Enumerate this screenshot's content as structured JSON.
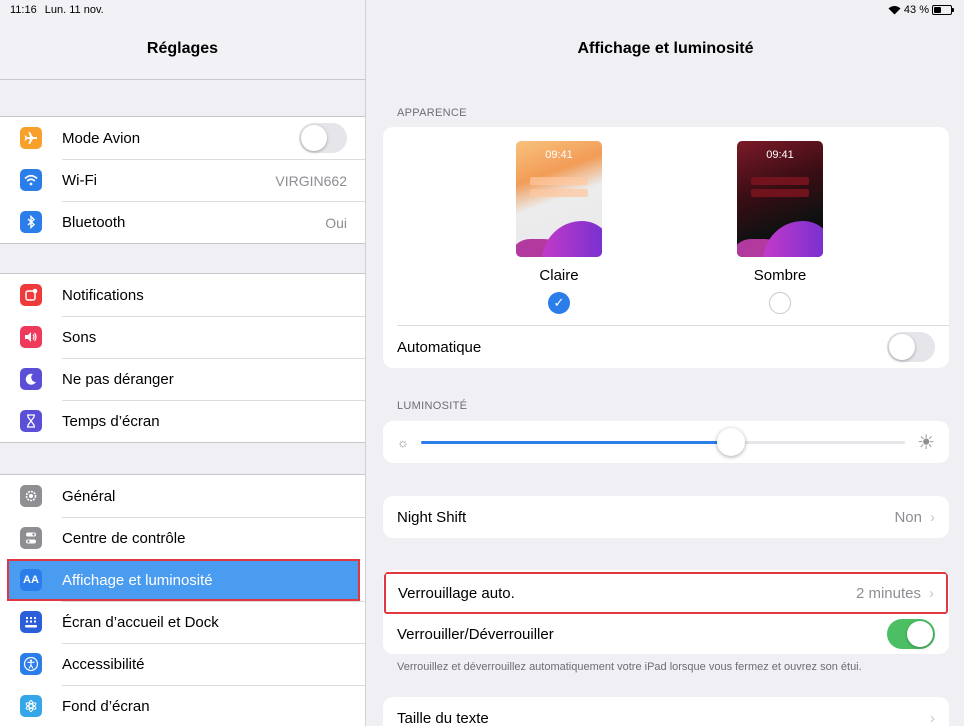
{
  "status_bar": {
    "time": "11:16",
    "date": "Lun. 11 nov.",
    "battery": "43 %",
    "battery_level": 0.43
  },
  "sidebar": {
    "title": "Réglages",
    "groups": [
      [
        {
          "label": "Mode Avion",
          "icon": "airplane-icon",
          "color": "#f7a12c",
          "toggle": false
        },
        {
          "label": "Wi-Fi",
          "icon": "wifi-icon",
          "color": "#2b7de9",
          "value": "VIRGIN662"
        },
        {
          "label": "Bluetooth",
          "icon": "bluetooth-icon",
          "color": "#2b7de9",
          "value": "Oui"
        }
      ],
      [
        {
          "label": "Notifications",
          "icon": "notifications-icon",
          "color": "#ee3a3a"
        },
        {
          "label": "Sons",
          "icon": "speaker-icon",
          "color": "#ee3a5b"
        },
        {
          "label": "Ne pas déranger",
          "icon": "moon-icon",
          "color": "#5a4fd6"
        },
        {
          "label": "Temps d’écran",
          "icon": "hourglass-icon",
          "color": "#5a4fd6"
        }
      ],
      [
        {
          "label": "Général",
          "icon": "gear-icon",
          "color": "#8e8e93"
        },
        {
          "label": "Centre de contrôle",
          "icon": "control-center-icon",
          "color": "#8e8e93"
        },
        {
          "label": "Affichage et luminosité",
          "icon": "text-size-icon",
          "color": "#2b7de9",
          "selected": true
        },
        {
          "label": "Écran d’accueil et Dock",
          "icon": "home-screen-icon",
          "color": "#2b5fd9"
        },
        {
          "label": "Accessibilité",
          "icon": "accessibility-icon",
          "color": "#2b7de9"
        },
        {
          "label": "Fond d’écran",
          "icon": "wallpaper-icon",
          "color": "#35a7e8"
        }
      ]
    ]
  },
  "main": {
    "title": "Affichage et luminosité",
    "appearance": {
      "section_label": "APPARENCE",
      "light": {
        "label": "Claire",
        "time": "09:41",
        "selected": true
      },
      "dark": {
        "label": "Sombre",
        "time": "09:41",
        "selected": false
      },
      "automatic_label": "Automatique",
      "automatic_on": false
    },
    "brightness": {
      "section_label": "LUMINOSITÉ",
      "level": 0.64
    },
    "night_shift": {
      "label": "Night Shift",
      "value": "Non"
    },
    "auto_lock": {
      "label": "Verrouillage auto.",
      "value": "2 minutes"
    },
    "lock_unlock": {
      "label": "Verrouiller/Déverrouiller",
      "on": true
    },
    "lock_footnote": "Verrouillez et déverrouillez automatiquement votre iPad lorsque vous fermez et ouvrez son étui.",
    "text_size": {
      "label": "Taille du texte"
    }
  }
}
